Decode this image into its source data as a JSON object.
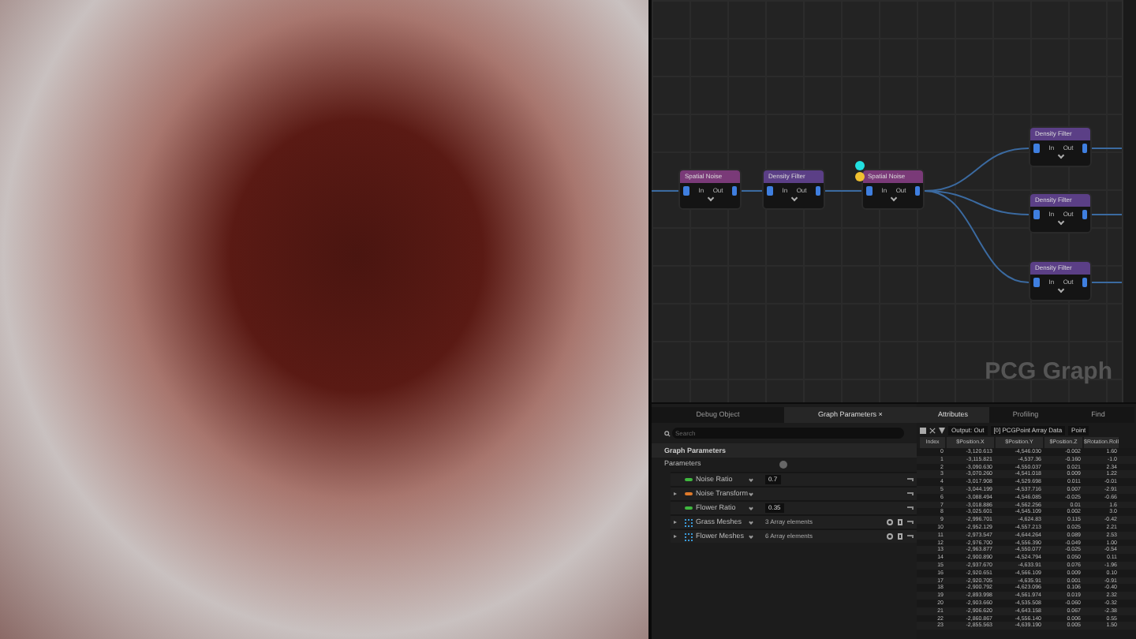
{
  "graph": {
    "watermark": "PCG Graph",
    "nodes": [
      {
        "title": "Spatial Noise",
        "color": "#7a3a78",
        "input": "In",
        "output": "Out",
        "markers": false
      },
      {
        "title": "Density Filter",
        "color": "#5b3f86",
        "input": "In",
        "output": "Out",
        "markers": false
      },
      {
        "title": "Spatial Noise",
        "color": "#7a3a78",
        "input": "In",
        "output": "Out",
        "markers": true
      },
      {
        "title": "Density Filter",
        "color": "#5b3f86",
        "input": "In",
        "output": "Out",
        "markers": false
      },
      {
        "title": "Density Filter",
        "color": "#5b3f86",
        "input": "In",
        "output": "Out",
        "markers": false
      },
      {
        "title": "Density Filter",
        "color": "#5b3f86",
        "input": "In",
        "output": "Out",
        "markers": false
      }
    ]
  },
  "parameters": {
    "tabs": [
      {
        "label": "Debug Object",
        "selected": false
      },
      {
        "label": "Graph Parameters ×",
        "selected": true
      }
    ],
    "search": {
      "placeholder": "Search"
    },
    "section": "Graph Parameters",
    "group": "Parameters",
    "rows": [
      {
        "name": "Noise Ratio",
        "kind": "scalar",
        "color": "#3fb83f",
        "expandable": false,
        "value": "0.7"
      },
      {
        "name": "Noise Transform",
        "kind": "scalar",
        "color": "#e07a2a",
        "expandable": true
      },
      {
        "name": "Flower Ratio",
        "kind": "scalar",
        "color": "#3fb83f",
        "expandable": false,
        "value": "0.35"
      },
      {
        "name": "Grass Meshes",
        "kind": "array",
        "color": "#3a9ad9",
        "expandable": true,
        "value": "3 Array elements"
      },
      {
        "name": "Flower Meshes",
        "kind": "array",
        "color": "#3a9ad9",
        "expandable": true,
        "value": "6 Array elements"
      }
    ]
  },
  "attributes": {
    "tabs": [
      {
        "label": "Attributes",
        "selected": true
      },
      {
        "label": "Profiling",
        "selected": false
      },
      {
        "label": "Find",
        "selected": false
      }
    ],
    "dropdowns": [
      "Output: Out",
      "[0] PCGPoint Array Data",
      "Point"
    ],
    "columns": [
      "Index",
      "$Position.X",
      "$Position.Y",
      "$Position.Z",
      "$Rotation.Roll"
    ],
    "rows": [
      [
        "0",
        "-3,120.613",
        "-4,546.030",
        "-0.002",
        "1.60"
      ],
      [
        "1",
        "-3,115.821",
        "-4,537.36",
        "-0.160",
        "-1.0"
      ],
      [
        "2",
        "-3,090.630",
        "-4,550.037",
        "0.021",
        "2.34"
      ],
      [
        "3",
        "-3,070.260",
        "-4,541.018",
        "0.009",
        "1.22"
      ],
      [
        "4",
        "-3,017.908",
        "-4,529.698",
        "0.011",
        "-0.01"
      ],
      [
        "5",
        "-3,044.199",
        "-4,537.716",
        "0.007",
        "-2.91"
      ],
      [
        "6",
        "-3,088.494",
        "-4,546.085",
        "-0.025",
        "-0.66"
      ],
      [
        "7",
        "-3,018.886",
        "-4,562.256",
        "0.01",
        "1.6"
      ],
      [
        "8",
        "-3,025.601",
        "-4,545.109",
        "0.002",
        "3.0"
      ],
      [
        "9",
        "-2,996.701",
        "-4,624.83",
        "0.115",
        "-0.42"
      ],
      [
        "10",
        "-2,952.129",
        "-4,557.213",
        "0.025",
        "2.21"
      ],
      [
        "11",
        "-2,973.547",
        "-4,644.264",
        "0.089",
        "2.53"
      ],
      [
        "12",
        "-2,976.700",
        "-4,556.390",
        "-0.049",
        "1.00"
      ],
      [
        "13",
        "-2,963.877",
        "-4,550.077",
        "-0.025",
        "-0.54"
      ],
      [
        "14",
        "-2,900.890",
        "-4,524.794",
        "0.050",
        "0.11"
      ],
      [
        "15",
        "-2,937.670",
        "-4,633.91",
        "0.076",
        "-1.96"
      ],
      [
        "16",
        "-2,920.651",
        "-4,566.109",
        "0.009",
        "0.10"
      ],
      [
        "17",
        "-2,920.705",
        "-4,635.91",
        "0.001",
        "-0.91"
      ],
      [
        "18",
        "-2,900.792",
        "-4,623.096",
        "0.106",
        "-0.40"
      ],
      [
        "19",
        "-2,893.998",
        "-4,561.974",
        "0.019",
        "2.32"
      ],
      [
        "20",
        "-2,903.660",
        "-4,535.508",
        "-0.060",
        "-0.32"
      ],
      [
        "21",
        "-2,906.620",
        "-4,643.158",
        "0.067",
        "-2.38"
      ],
      [
        "22",
        "-2,860.867",
        "-4,556.140",
        "0.006",
        "0.55"
      ],
      [
        "23",
        "-2,855.563",
        "-4,639.190",
        "0.005",
        "1.50"
      ]
    ]
  }
}
